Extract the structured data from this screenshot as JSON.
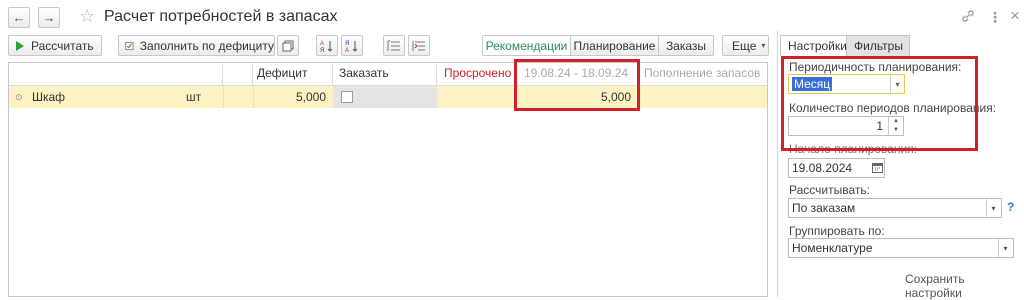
{
  "window": {
    "title": "Расчет потребностей в запасах",
    "back_icon": "←",
    "forward_icon": "→",
    "star_icon": "☆",
    "link_icon": "🔗",
    "more_icon": "⋮",
    "close_icon": "×"
  },
  "toolbar": {
    "calculate_label": "Рассчитать",
    "fill_deficit_label": "Заполнить по дефициту",
    "more_label": "Еще",
    "view_tabs": [
      "Рекомендации",
      "Планирование",
      "Заказы"
    ]
  },
  "table": {
    "columns": [
      "Дефицит",
      "Заказать",
      "Просрочено",
      "19.08.24 - 18.09.24",
      "Пополнение запасов"
    ],
    "rows": [
      {
        "name": "Шкаф",
        "unit": "шт",
        "deficit": "5,000",
        "order": false,
        "overdue": "",
        "period": "5,000",
        "replenish": ""
      }
    ]
  },
  "panel": {
    "tabs": [
      "Настройки",
      "Фильтры"
    ],
    "periodicity_label": "Периодичность планирования:",
    "periodicity_value": "Месяц",
    "periods_count_label": "Количество периодов планирования:",
    "periods_count_value": "1",
    "start_label": "Начало планирования:",
    "start_value": "19.08.2024",
    "calculate_by_label": "Рассчитывать:",
    "calculate_by_value": "По заказам",
    "help_mark": "?",
    "group_by_label": "Группировать по:",
    "group_by_value": "Номенклатуре",
    "save_settings_label": "Сохранить настройки"
  },
  "colors": {
    "row_highlight": "#fdf2c4",
    "overdue_red": "#d0202a",
    "active_tab_green": "#2e8b57",
    "selection_blue": "#3a6fd8"
  }
}
